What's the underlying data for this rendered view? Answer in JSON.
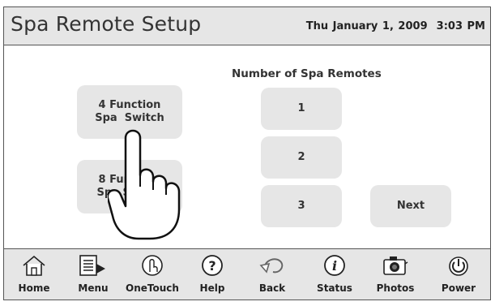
{
  "header": {
    "title": "Spa Remote Setup",
    "datetime": "Thu January 1, 2009  3:03 PM"
  },
  "main": {
    "section_label": "Number of Spa Remotes",
    "switch_buttons": [
      {
        "line1": "4 Function",
        "line2": "Spa  Switch"
      },
      {
        "line1": "8 Function",
        "line2": "Spa Switch"
      }
    ],
    "count_buttons": [
      "1",
      "2",
      "3"
    ],
    "next_label": "Next"
  },
  "toolbar": {
    "items": [
      {
        "label": "Home",
        "icon": "home-icon"
      },
      {
        "label": "Menu",
        "icon": "menu-icon"
      },
      {
        "label": "OneTouch",
        "icon": "onetouch-icon"
      },
      {
        "label": "Help",
        "icon": "help-icon"
      },
      {
        "label": "Back",
        "icon": "back-icon"
      },
      {
        "label": "Status",
        "icon": "status-icon"
      },
      {
        "label": "Photos",
        "icon": "camera-icon"
      },
      {
        "label": "Power",
        "icon": "power-icon"
      }
    ]
  },
  "colors": {
    "panel": "#e6e6e6",
    "border": "#555555",
    "text": "#333333"
  }
}
